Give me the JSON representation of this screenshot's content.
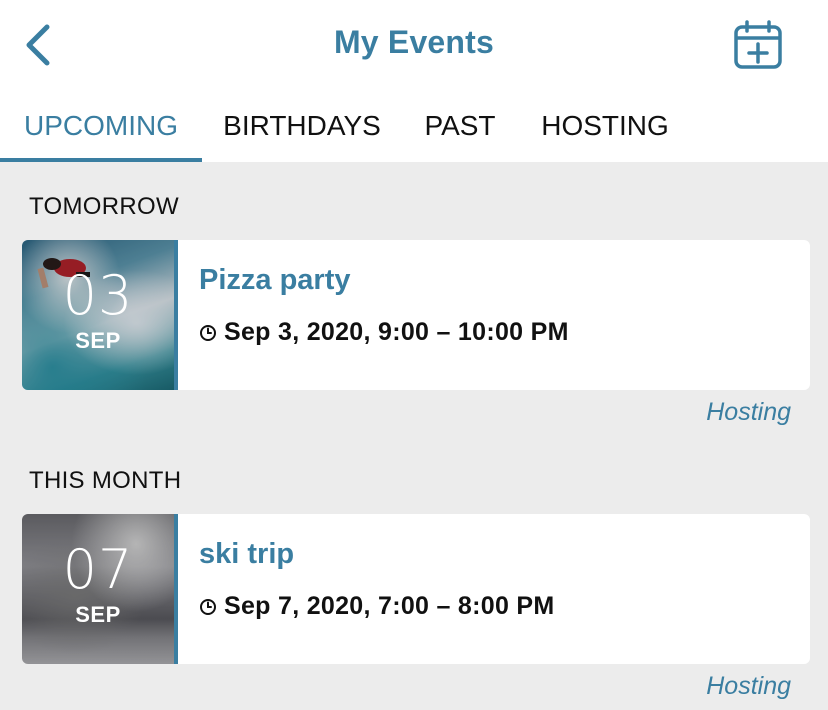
{
  "header": {
    "title": "My Events",
    "accent_color": "#3a7ea1",
    "back_icon": "chevron-left-icon",
    "add_icon": "calendar-plus-icon"
  },
  "tabs": [
    {
      "label": "UPCOMING",
      "active": true
    },
    {
      "label": "BIRTHDAYS",
      "active": false
    },
    {
      "label": "PAST",
      "active": false
    },
    {
      "label": "HOSTING",
      "active": false
    }
  ],
  "sections": [
    {
      "heading": "TOMORROW",
      "events": [
        {
          "day": "03",
          "month": "SEP",
          "title": "Pizza party",
          "time": "Sep 3, 2020, 9:00 – 10:00 PM",
          "role": "Hosting",
          "thumbnail": "surfing-wave-photo"
        }
      ]
    },
    {
      "heading": "THIS MONTH",
      "events": [
        {
          "day": "07",
          "month": "SEP",
          "title": "ski trip",
          "time": "Sep 7, 2020, 7:00 – 8:00 PM",
          "role": "Hosting",
          "thumbnail": "ski-slope-photo"
        }
      ]
    }
  ]
}
